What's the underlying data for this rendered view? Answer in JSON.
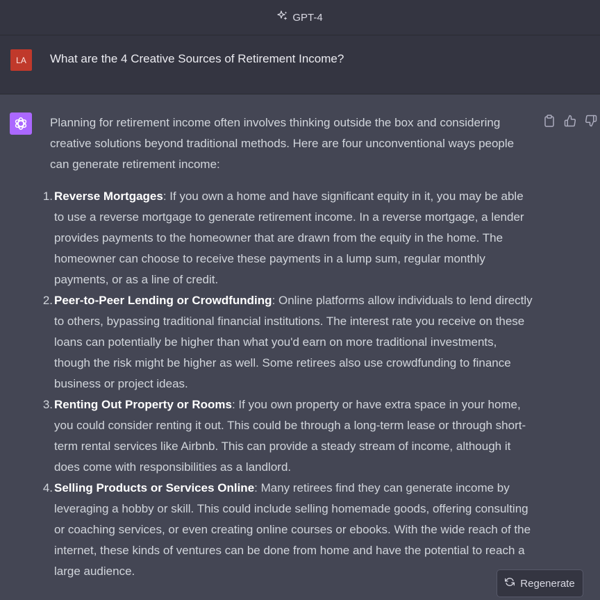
{
  "header": {
    "model_label": "GPT-4",
    "model_icon": "sparkles-icon"
  },
  "user": {
    "avatar_initials": "LA",
    "avatar_color": "#c0392b",
    "message": "What are the 4 Creative Sources of Retirement Income?"
  },
  "assistant": {
    "avatar_color": "#ab68ff",
    "intro": "Planning for retirement income often involves thinking outside the box and considering creative solutions beyond traditional methods. Here are four unconventional ways people can generate retirement income:",
    "items": [
      {
        "num": "1.",
        "title": "Reverse Mortgages",
        "text": ": If you own a home and have significant equity in it, you may be able to use a reverse mortgage to generate retirement income. In a reverse mortgage, a lender provides payments to the homeowner that are drawn from the equity in the home. The homeowner can choose to receive these payments in a lump sum, regular monthly payments, or as a line of credit."
      },
      {
        "num": "2.",
        "title": "Peer-to-Peer Lending or Crowdfunding",
        "text": ": Online platforms allow individuals to lend directly to others, bypassing traditional financial institutions. The interest rate you receive on these loans can potentially be higher than what you'd earn on more traditional investments, though the risk might be higher as well. Some retirees also use crowdfunding to finance business or project ideas."
      },
      {
        "num": "3.",
        "title": "Renting Out Property or Rooms",
        "text": ": If you own property or have extra space in your home, you could consider renting it out. This could be through a long-term lease or through short-term rental services like Airbnb. This can provide a steady stream of income, although it does come with responsibilities as a landlord."
      },
      {
        "num": "4.",
        "title": "Selling Products or Services Online",
        "text": ": Many retirees find they can generate income by leveraging a hobby or skill. This could include selling homemade goods, offering consulting or coaching services, or even creating online courses or ebooks. With the wide reach of the internet, these kinds of ventures can be done from home and have the potential to reach a large audience."
      }
    ]
  },
  "actions": {
    "copy_icon": "clipboard-icon",
    "like_icon": "thumbs-up-icon",
    "dislike_icon": "thumbs-down-icon"
  },
  "regenerate": {
    "label": "Regenerate",
    "icon": "refresh-icon"
  }
}
